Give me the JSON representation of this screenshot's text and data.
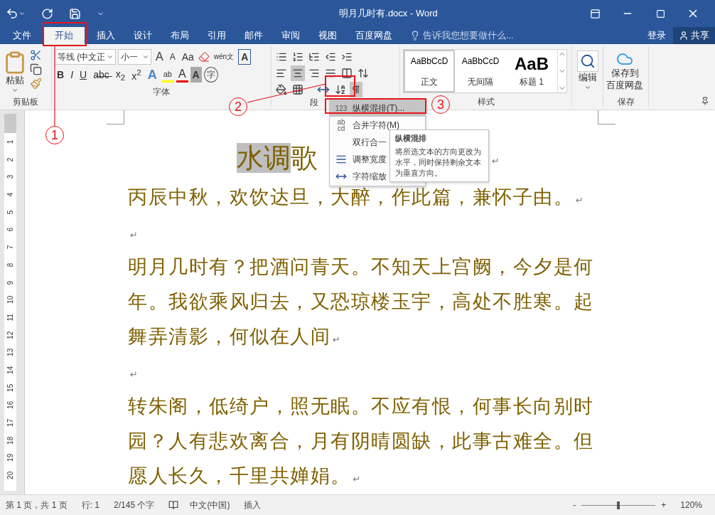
{
  "window": {
    "title": "明月几时有.docx - Word"
  },
  "tabs": [
    {
      "label": "文件",
      "selected": false
    },
    {
      "label": "开始",
      "selected": true
    },
    {
      "label": "插入",
      "selected": false
    },
    {
      "label": "设计",
      "selected": false
    },
    {
      "label": "布局",
      "selected": false
    },
    {
      "label": "引用",
      "selected": false
    },
    {
      "label": "邮件",
      "selected": false
    },
    {
      "label": "审阅",
      "selected": false
    },
    {
      "label": "视图",
      "selected": false
    },
    {
      "label": "百度网盘",
      "selected": false
    }
  ],
  "tell_me": {
    "placeholder": "告诉我您想要做什么..."
  },
  "account": {
    "sign_in": "登录",
    "share": "共享"
  },
  "ribbon": {
    "clipboard": {
      "paste": "粘贴",
      "label": "剪贴板"
    },
    "font": {
      "name": "等线 (中文正",
      "size": "小一",
      "grow": "A",
      "shrink": "A",
      "case": "Aa",
      "phonetic": "wén",
      "phonetic_char": "文",
      "border_char": "A",
      "styles": [
        "B",
        "I",
        "U",
        "a̶b̶c̶",
        "x$_{2}$",
        "x$^{2}$"
      ],
      "effect": "A",
      "highlight": "ab",
      "color_char": "A",
      "shade_char": "A",
      "enclose": "字",
      "label": "字体"
    },
    "paragraph": {
      "alignments": [
        {
          "selected": false
        },
        {
          "selected": true
        },
        {
          "selected": false
        },
        {
          "selected": false
        },
        {
          "selected": false
        }
      ],
      "label": "段"
    },
    "styles": {
      "items": [
        {
          "preview": "AaBbCcD",
          "name": "正文",
          "selected": true,
          "kind": "normal"
        },
        {
          "preview": "AaBbCcD",
          "name": "无间隔",
          "selected": false,
          "kind": "normal"
        },
        {
          "preview": "AaB",
          "name": "标题 1",
          "selected": false,
          "kind": "heading"
        }
      ],
      "label": "样式"
    },
    "editing": {
      "label": "编辑"
    },
    "save": {
      "lines": [
        "保存到",
        "百度网盘"
      ],
      "label": "保存"
    }
  },
  "menu": {
    "items": [
      {
        "label": "纵横混排(T)...",
        "kind": "numbers",
        "icon_text": "123",
        "selected": true
      },
      {
        "label": "合并字符(M)",
        "kind": "letters",
        "icon_lines": [
          "ab",
          "cd"
        ],
        "selected": false
      },
      {
        "label": "双行合一",
        "kind": "plain",
        "selected": false
      },
      {
        "label": "调整宽度",
        "kind": "width",
        "selected": false
      },
      {
        "label": "字符缩放",
        "kind": "scale",
        "selected": false
      }
    ]
  },
  "tooltip": {
    "title": "纵横混排",
    "text": "将所选文本的方向更改为水平，同时保持剩余文本为垂直方向。"
  },
  "ruler": {
    "marks": [
      "1",
      "2",
      "3",
      "4",
      "5",
      "6",
      "7",
      "8",
      "9",
      "10",
      "11",
      "12",
      "13",
      "14",
      "15",
      "16",
      "17",
      "18",
      "19",
      "20"
    ]
  },
  "document": {
    "heading": {
      "selected_text": "水调",
      "text": "歌",
      "end_mark": "↵"
    },
    "paragraphs": [
      {
        "text": "丙辰中秋，欢饮达旦，大醉，作此篇，兼怀子由。",
        "end_mark": "↵"
      },
      {
        "end_mark": "↵"
      },
      {
        "text": "明月几时有？把酒问青天。不知天上宫阙，今夕是何年。我欲乘风归去，又恐琼楼玉宇，高处不胜寒。起舞弄清影，何似在人间",
        "end_mark": "↵"
      },
      {
        "end_mark": "↵"
      },
      {
        "text": "转朱阁，低绮户，照无眠。不应有恨，何事长向别时园？人有悲欢离合，月有阴晴圆缺，此事古难全。但愿人长久，千里共婵娟。",
        "end_mark": "↵"
      }
    ]
  },
  "status_bar": {
    "page": "第 1 页，共 1 页",
    "line": "行: 1",
    "words": "2/145 个字",
    "language": "中文(中国)",
    "mode": "插入",
    "zoom_out": "-",
    "zoom_in": "+",
    "zoom": {
      "level": 0.5
    },
    "zoom_percent": "120%"
  },
  "annotations": [
    {
      "label": "1"
    },
    {
      "label": "2"
    },
    {
      "label": "3"
    }
  ]
}
